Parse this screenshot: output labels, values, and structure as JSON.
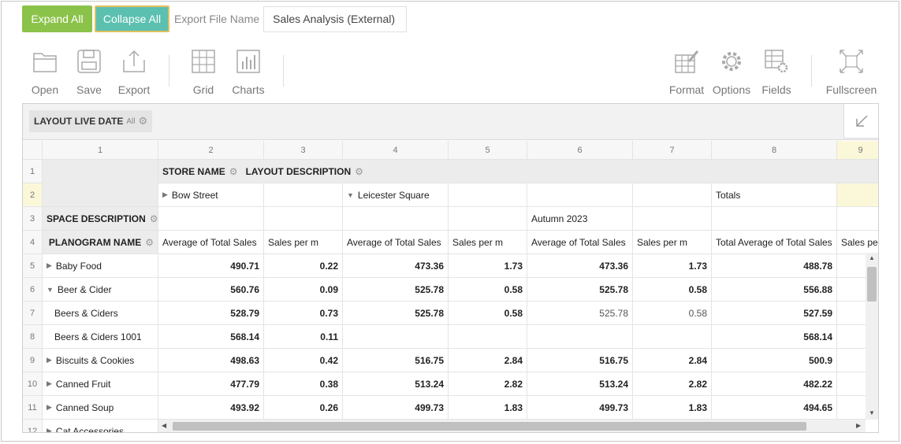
{
  "topbar": {
    "expand_label": "Expand All",
    "collapse_label": "Collapse All",
    "export_label": "Export File Name",
    "export_value": "Sales Analysis (External)"
  },
  "toolbar": {
    "open": "Open",
    "save": "Save",
    "export": "Export",
    "grid": "Grid",
    "charts": "Charts",
    "format": "Format",
    "options": "Options",
    "fields": "Fields",
    "fullscreen": "Fullscreen"
  },
  "filter": {
    "name": "LAYOUT LIVE DATE",
    "value": "All"
  },
  "columns": [
    "1",
    "2",
    "3",
    "4",
    "5",
    "6",
    "7",
    "8",
    "9"
  ],
  "rows": [
    "1",
    "2",
    "3",
    "4",
    "5",
    "6",
    "7",
    "8",
    "9",
    "10",
    "11",
    "12"
  ],
  "headers": {
    "store_name": "STORE NAME",
    "layout_description": "LAYOUT DESCRIPTION",
    "space_description": "SPACE DESCRIPTION",
    "planogram_name": "PLANOGRAM NAME",
    "bow_street": "Bow Street",
    "leicester_square": "Leicester Square",
    "totals": "Totals",
    "autumn": "Autumn 2023",
    "avg_total_sales": "Average of Total Sales",
    "sales_per_m": "Sales per m",
    "total_avg_total_sales": "Total Average of Total Sales",
    "sales_per_trunc": "Sales per"
  },
  "data_rows": [
    {
      "name": "Baby Food",
      "toggle": "▶",
      "values": [
        "490.71",
        "0.22",
        "473.36",
        "1.73",
        "473.36",
        "1.73",
        "488.78"
      ]
    },
    {
      "name": "Beer & Cider",
      "toggle": "▼",
      "values": [
        "560.76",
        "0.09",
        "525.78",
        "0.58",
        "525.78",
        "0.58",
        "556.88"
      ]
    },
    {
      "name": "Beers & Ciders",
      "toggle": "",
      "values": [
        "528.79",
        "0.73",
        "525.78",
        "0.58",
        "525.78",
        "0.58",
        "527.59"
      ]
    },
    {
      "name": "Beers & Ciders 1001",
      "toggle": "",
      "values": [
        "568.14",
        "0.11",
        "",
        "",
        "",
        "",
        "568.14"
      ]
    },
    {
      "name": "Biscuits & Cookies",
      "toggle": "▶",
      "values": [
        "498.63",
        "0.42",
        "516.75",
        "2.84",
        "516.75",
        "2.84",
        "500.9"
      ]
    },
    {
      "name": "Canned Fruit",
      "toggle": "▶",
      "values": [
        "477.79",
        "0.38",
        "513.24",
        "2.82",
        "513.24",
        "2.82",
        "482.22"
      ]
    },
    {
      "name": "Canned Soup",
      "toggle": "▶",
      "values": [
        "493.92",
        "0.26",
        "499.73",
        "1.83",
        "499.73",
        "1.83",
        "494.65"
      ]
    },
    {
      "name": "Cat Accessories",
      "toggle": "▶",
      "values": [
        "",
        "",
        "",
        "",
        "",
        "",
        ""
      ]
    }
  ]
}
